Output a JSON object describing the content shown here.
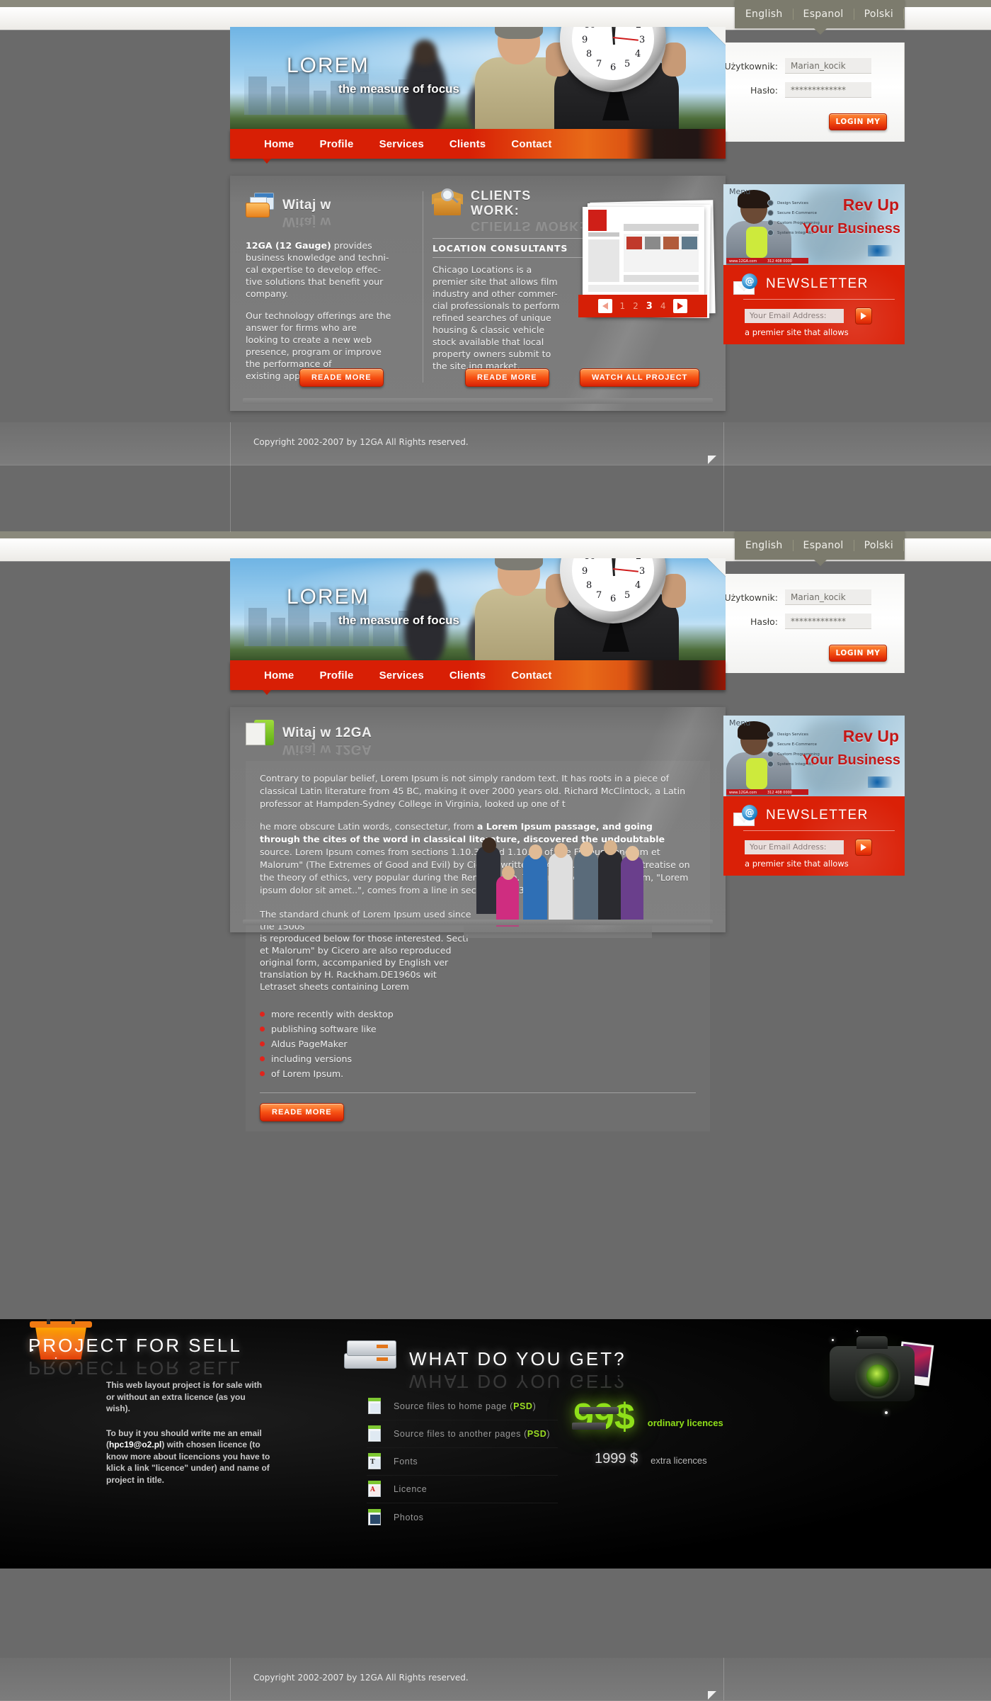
{
  "site": {
    "brand": "LOREM",
    "tagline": "the measure of focus"
  },
  "languages": [
    "English",
    "Espanol",
    "Polski"
  ],
  "login": {
    "user_label": "Użytkownik:",
    "user_value": "Marian_kocik",
    "pass_label": "Hasło:",
    "pass_value": "*************",
    "button": "LOGIN MY"
  },
  "nav": [
    "Home",
    "Profile",
    "Services",
    "Clients",
    "Contact"
  ],
  "home": {
    "welcome": {
      "icon": "window-folder-icon",
      "title": "Witaj w",
      "paragraphs": [
        "12GA (12 Gauge) provides business knowledge and technical expertise to develop effective solutions that benefit your company.",
        "Our technology offerings are the answer for firms who are looking to create a new web presence, program or improve the performance of existing applications."
      ],
      "bold_lead": "12GA (12 Gauge)",
      "rest_lead": " provides business knowledge and techni-",
      "line2": "cal expertise to develop effec-",
      "line3": "tive solutions that benefit your",
      "line4": "company.",
      "p2_lines": [
        "Our technology offerings are the",
        "answer for firms who are",
        "looking to create a new web",
        "presence, program or improve",
        "the performance of",
        "existing applications."
      ],
      "button": "READE MORE"
    },
    "clients": {
      "icon": "box-magnifier-icon",
      "title": "CLIENTS WORK:",
      "subtitle": "LOCATION CONSULTANTS",
      "body_lines": [
        "Chicago Locations is a",
        "premier site that allows film",
        "industry and other commer-",
        "cial professionals to perform",
        "refined searches of unique",
        "housing & classic vehicle",
        "stock available that local",
        "property owners submit to",
        "the site.ing market."
      ],
      "button": "READE MORE",
      "watch_button": "WATCH ALL PROJECT",
      "pager": [
        "1",
        "2",
        "3",
        "4"
      ],
      "pager_active": "3"
    }
  },
  "about": {
    "icon": "document-green-icon",
    "title": "Witaj w 12GA",
    "p1": "Contrary to popular belief, Lorem Ipsum is not simply random text. It has roots in a piece of classical Latin literature from 45 BC, making it over 2000 years old. Richard McClintock, a Latin professor at Hampden-Sydney College in Virginia, looked up one of t",
    "p2_a": "he more obscure Latin words, consectetur, from ",
    "p2_b": "a Lorem Ipsum passage, and going through the cites of the word in classical literature, discovered the undoubtable",
    "p2_c": " source. Lorem Ipsum comes from sections 1.10.32 and 1.10.33 of \"de Finibus Bonorum et Malorum\" (The Extremes of Good and Evil) by Cicero, written in 45 BC. This book is a treatise on the theory of ethics, very popular during the Renaissance. The first line of Lorem Ipsum, \"Lorem ipsum dolor sit amet..\", comes from a line in section 1.10.32.",
    "p3_lines": [
      "The standard chunk of Lorem Ipsum used since the 1500s",
      "is reproduced below for those interested. Secti",
      "et Malorum\" by Cicero are also reproduced",
      "original form, accompanied by English ver",
      "translation by H. Rackham.DE1960s wit",
      "Letraset sheets containing Lorem"
    ],
    "bullets": [
      "more recently with desktop",
      "publishing software like",
      "Aldus PageMaker",
      "including versions",
      "of Lorem Ipsum."
    ],
    "button": "READE MORE"
  },
  "sidebar": {
    "banner": {
      "menu_label": "Menu",
      "headline_1": "Rev Up",
      "headline_2": "Your Business",
      "bullets": [
        "Design Services",
        "Secure E-Commerce",
        "Custom Programming",
        "Systems Integration"
      ],
      "phone": "312 408 0000",
      "small_left": "www.12GA.com"
    },
    "newsletter": {
      "icon": "email-at-icon",
      "title": "NEWSLETTER",
      "placeholder": "Your Email Address:",
      "submit_icon": "arrow-right-icon",
      "note": "a premier site that allows"
    }
  },
  "footer": {
    "copyright": "Copyright 2002-2007 by 12GA All Rights reserved."
  },
  "promo": {
    "sell": {
      "icon": "shopping-basket-icon",
      "title": "PROJECT FOR SELL",
      "p1": "This web layout project is for sale with or without an extra licence (as you wish).",
      "p2_a": "To buy it you should write me an email (",
      "p2_email": "hpc19@o2.pl",
      "p2_b": ") with chosen licence (to know more about licencions you have to klick a link \"licence\" under) and name of project in title."
    },
    "get": {
      "icon": "paper-stack-icon",
      "title": "WHAT DO YOU GET?",
      "items": [
        {
          "icon": "file-psd-icon",
          "label": "Source files to home page (",
          "tag": "PSD",
          "label_end": ")"
        },
        {
          "icon": "file-psd-icon",
          "label": "Source files to another pages (",
          "tag": "PSD",
          "label_end": ")"
        },
        {
          "icon": "file-font-icon",
          "label": "Fonts",
          "tag": "",
          "label_end": ""
        },
        {
          "icon": "file-pdf-icon",
          "label": "Licence",
          "tag": "",
          "label_end": ""
        },
        {
          "icon": "file-photo-icon",
          "label": "Photos",
          "tag": "",
          "label_end": ""
        }
      ]
    },
    "pricing": {
      "icon": "camera-icon",
      "main_price": "99$",
      "main_label": "ordinary licences",
      "extra_price": "1999 $",
      "extra_label": "extra licences"
    }
  },
  "colors": {
    "accent_red": "#d81f05",
    "orange": "#f64f12",
    "green": "#8fe01a",
    "olive": "#7c7b6d",
    "panel_gray": "#7a7a7a"
  }
}
